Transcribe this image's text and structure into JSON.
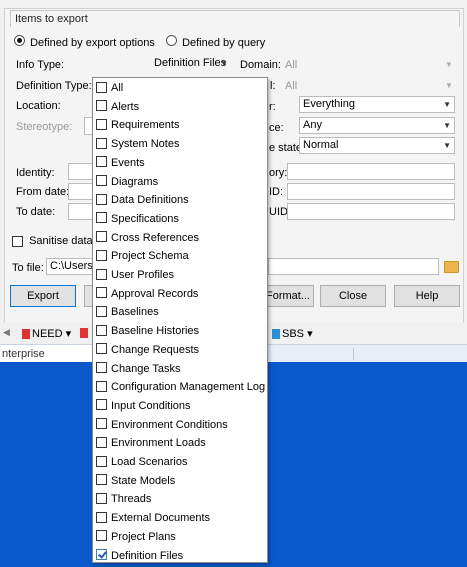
{
  "group": {
    "title": "Items to export"
  },
  "mode": {
    "option1": "Defined by export options",
    "option2": "Defined by query",
    "selected": "option1"
  },
  "labels": {
    "info_type": "Info Type:",
    "definition_type": "Definition Type:",
    "location": "Location:",
    "stereotype": "Stereotype:",
    "identity": "Identity:",
    "from_date": "From date:",
    "to_date": "To date:",
    "domain": "Domain:",
    "domain_value": "All",
    "row2_right_label": "l:",
    "row2_right_value": "All",
    "row3_right_label": "r:",
    "row4_right_label": "ce:",
    "row5_right_label": "e state:",
    "row6_right_label": "ory:",
    "row7_right_label": "ID:",
    "row8_right_label": "UID:"
  },
  "fields": {
    "info_type_value": "Definition Files",
    "row3_value": "Everything",
    "row4_value": "Any",
    "row5_value": "Normal"
  },
  "sanitise": {
    "label": "Sanitise data"
  },
  "tofile": {
    "label": "To file:",
    "value": "C:\\Users\\"
  },
  "buttons": {
    "export": "Export",
    "format": "Format...",
    "close": "Close",
    "help": "Help"
  },
  "toolbar": {
    "need": "NEED",
    "sbs": "SBS"
  },
  "tab": {
    "label": "nterprise"
  },
  "dropdown_items": [
    {
      "label": "All",
      "checked": false
    },
    {
      "label": "Alerts",
      "checked": false
    },
    {
      "label": "Requirements",
      "checked": false
    },
    {
      "label": "System Notes",
      "checked": false
    },
    {
      "label": "Events",
      "checked": false
    },
    {
      "label": "Diagrams",
      "checked": false
    },
    {
      "label": "Data Definitions",
      "checked": false
    },
    {
      "label": "Specifications",
      "checked": false
    },
    {
      "label": "Cross References",
      "checked": false
    },
    {
      "label": "Project Schema",
      "checked": false
    },
    {
      "label": "User Profiles",
      "checked": false
    },
    {
      "label": "Approval Records",
      "checked": false
    },
    {
      "label": "Baselines",
      "checked": false
    },
    {
      "label": "Baseline Histories",
      "checked": false
    },
    {
      "label": "Change Requests",
      "checked": false
    },
    {
      "label": "Change Tasks",
      "checked": false
    },
    {
      "label": "Configuration Management Log",
      "checked": false
    },
    {
      "label": "Input Conditions",
      "checked": false
    },
    {
      "label": "Environment Conditions",
      "checked": false
    },
    {
      "label": "Environment Loads",
      "checked": false
    },
    {
      "label": "Load Scenarios",
      "checked": false
    },
    {
      "label": "State Models",
      "checked": false
    },
    {
      "label": "Threads",
      "checked": false
    },
    {
      "label": "External Documents",
      "checked": false
    },
    {
      "label": "Project Plans",
      "checked": false
    },
    {
      "label": "Definition Files",
      "checked": true
    }
  ]
}
